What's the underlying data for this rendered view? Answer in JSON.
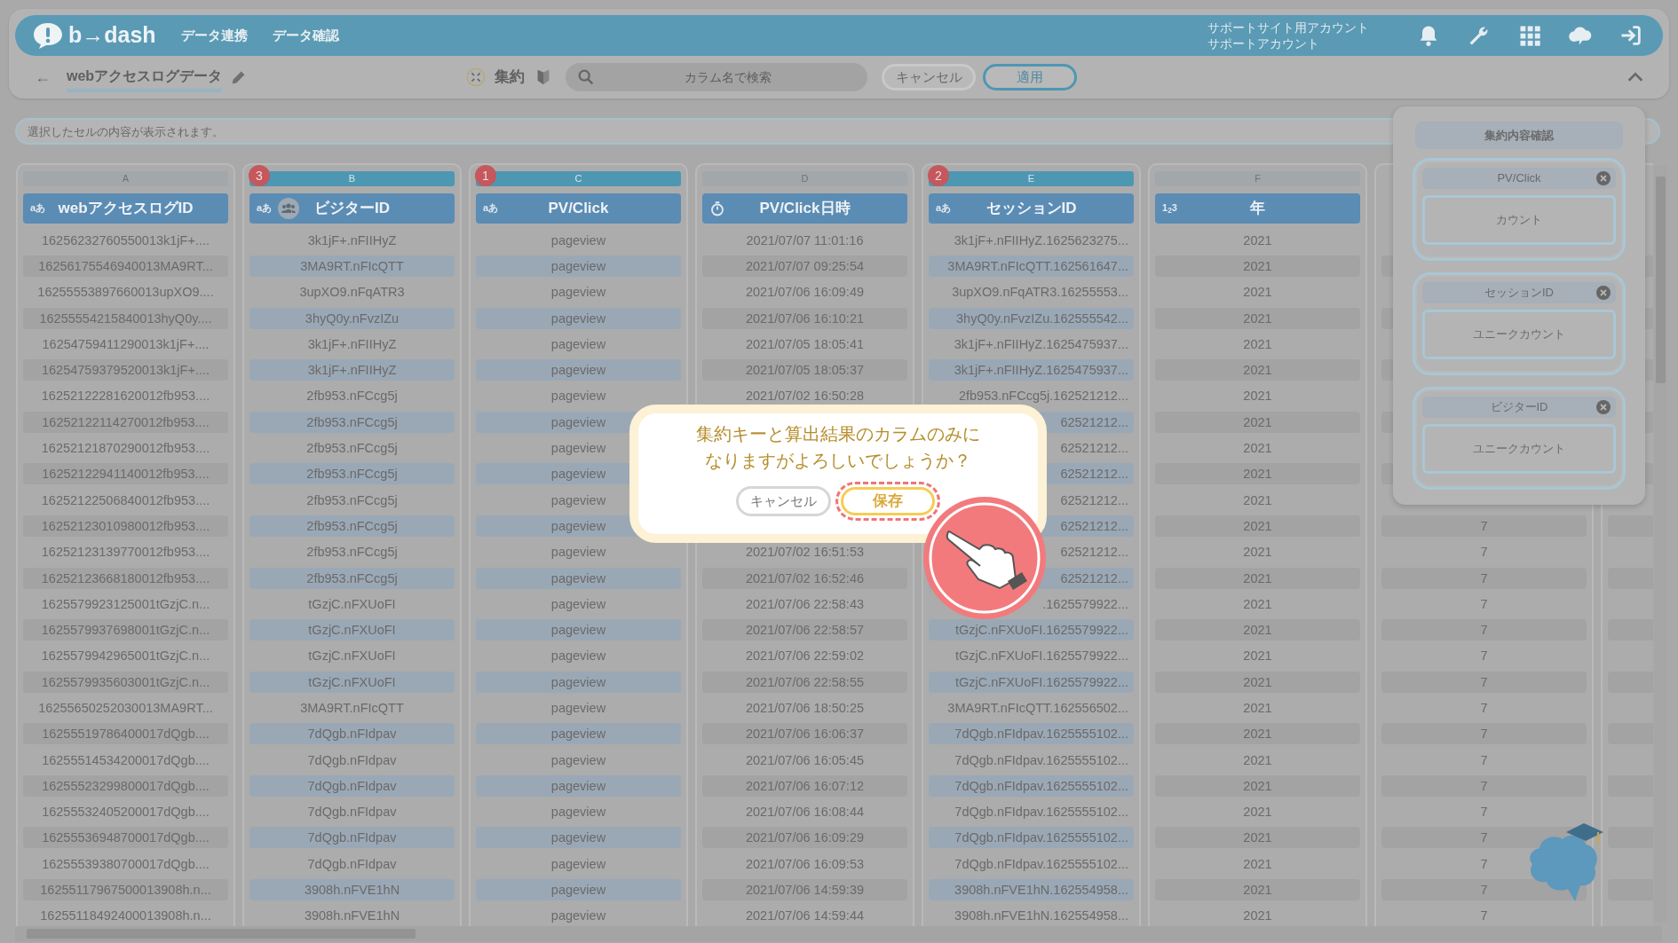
{
  "navbar": {
    "logo": "b→dash",
    "menu": [
      "データ連携",
      "データ確認"
    ],
    "account": [
      "サポートサイト用アカウント",
      "サポートアカウント"
    ]
  },
  "toolbar": {
    "back": "←",
    "title": "webアクセスログデータ",
    "aggregate_label": "集約",
    "search_placeholder": "カラム名で検索",
    "cancel": "キャンセル",
    "apply": "適用"
  },
  "cell_viewer": {
    "placeholder": "選択したセルの内容が表示されます。"
  },
  "columns": [
    {
      "letter": "A",
      "selected": false,
      "name": "webアクセスログID",
      "kind": "text",
      "type_label": "aあ",
      "visitor_key": false
    },
    {
      "letter": "B",
      "selected": true,
      "name": "ビジターID",
      "kind": "text",
      "type_label": "aあ",
      "visitor_key": true,
      "order": "3"
    },
    {
      "letter": "C",
      "selected": true,
      "name": "PV/Click",
      "kind": "text",
      "type_label": "aあ",
      "visitor_key": false,
      "order": "1"
    },
    {
      "letter": "D",
      "selected": false,
      "name": "PV/Click日時",
      "kind": "datetime",
      "visitor_key": false
    },
    {
      "letter": "E",
      "selected": true,
      "name": "セッションID",
      "kind": "text",
      "type_label": "aあ",
      "visitor_key": false,
      "order": "2"
    },
    {
      "letter": "F",
      "selected": false,
      "name": "年",
      "kind": "number",
      "type_label": "1$_{2}$3",
      "visitor_key": false
    }
  ],
  "rows": [
    {
      "cells": [
        "16256232760550013k1jF+....",
        "3k1jF+.nFIIHyZ",
        "pageview",
        "2021/07/07 11:01:16",
        "3k1jF+.nFIIHyZ.1625623275...",
        "2021"
      ]
    },
    {
      "cells": [
        "16256175546940013MA9RT...",
        "3MA9RT.nFIcQTT",
        "pageview",
        "2021/07/07 09:25:54",
        "3MA9RT.nFIcQTT.162561647...",
        "2021"
      ]
    },
    {
      "cells": [
        "16255553897660013upXO9....",
        "3upXO9.nFqATR3",
        "pageview",
        "2021/07/06 16:09:49",
        "3upXO9.nFqATR3.16255553...",
        "2021"
      ]
    },
    {
      "cells": [
        "16255554215840013hyQ0y....",
        "3hyQ0y.nFvzIZu",
        "pageview",
        "2021/07/06 16:10:21",
        "3hyQ0y.nFvzIZu.162555542...",
        "2021"
      ]
    },
    {
      "cells": [
        "16254759411290013k1jF+....",
        "3k1jF+.nFIIHyZ",
        "pageview",
        "2021/07/05 18:05:41",
        "3k1jF+.nFIIHyZ.1625475937...",
        "2021"
      ]
    },
    {
      "cells": [
        "16254759379520013k1jF+....",
        "3k1jF+.nFIIHyZ",
        "pageview",
        "2021/07/05 18:05:37",
        "3k1jF+.nFIIHyZ.1625475937...",
        "2021"
      ]
    },
    {
      "cells": [
        "16252122281620012fb953....",
        "2fb953.nFCcg5j",
        "pageview",
        "2021/07/02 16:50:28",
        "2fb953.nFCcg5j.162521212...",
        "2021"
      ]
    },
    {
      "cells": [
        "16252122114270012fb953....",
        "2fb953.nFCcg5j",
        "pageview",
        null,
        "62521212...",
        "2021"
      ]
    },
    {
      "cells": [
        "16252121870290012fb953....",
        "2fb953.nFCcg5j",
        "pageview",
        null,
        "62521212...",
        "2021"
      ]
    },
    {
      "cells": [
        "16252122941140012fb953....",
        "2fb953.nFCcg5j",
        "pageview",
        null,
        "62521212...",
        "2021"
      ]
    },
    {
      "cells": [
        "16252122506840012fb953....",
        "2fb953.nFCcg5j",
        "pageview",
        null,
        "62521212...",
        "2021"
      ]
    },
    {
      "cells": [
        "16252123010980012fb953....",
        "2fb953.nFCcg5j",
        "pageview",
        null,
        "62521212...",
        "2021"
      ],
      "column_7": "7"
    },
    {
      "cells": [
        "16252123139770012fb953....",
        "2fb953.nFCcg5j",
        "pageview",
        "2021/07/02 16:51:53",
        "62521212...",
        "2021"
      ],
      "column_7": "7"
    },
    {
      "cells": [
        "16252123668180012fb953....",
        "2fb953.nFCcg5j",
        "pageview",
        "2021/07/02 16:52:46",
        "62521212...",
        "2021"
      ],
      "column_7": "7"
    },
    {
      "cells": [
        "1625579923125001tGzjC.n...",
        "tGzjC.nFXUoFI",
        "pageview",
        "2021/07/06 22:58:43",
        ".1625579922...",
        "2021"
      ],
      "column_7": "7"
    },
    {
      "cells": [
        "1625579937698001tGzjC.n...",
        "tGzjC.nFXUoFI",
        "pageview",
        "2021/07/06 22:58:57",
        "tGzjC.nFXUoFI.1625579922...",
        "2021"
      ],
      "column_7": "7"
    },
    {
      "cells": [
        "1625579942965001tGzjC.n...",
        "tGzjC.nFXUoFI",
        "pageview",
        "2021/07/06 22:59:02",
        "tGzjC.nFXUoFI.1625579922...",
        "2021"
      ],
      "column_7": "7"
    },
    {
      "cells": [
        "1625579935603001tGzjC.n...",
        "tGzjC.nFXUoFI",
        "pageview",
        "2021/07/06 22:58:55",
        "tGzjC.nFXUoFI.1625579922...",
        "2021"
      ],
      "column_7": "7"
    },
    {
      "cells": [
        "16255650252030013MA9RT...",
        "3MA9RT.nFIcQTT",
        "pageview",
        "2021/07/06 18:50:25",
        "3MA9RT.nFIcQTT.162556502...",
        "2021"
      ],
      "column_7": "7"
    },
    {
      "cells": [
        "16255519786400017dQgb....",
        "7dQgb.nFIdpav",
        "pageview",
        "2021/07/06 16:06:37",
        "7dQgb.nFIdpav.1625555102...",
        "2021"
      ],
      "column_7": "7"
    },
    {
      "cells": [
        "16255514534200017dQgb....",
        "7dQgb.nFIdpav",
        "pageview",
        "2021/07/06 16:05:45",
        "7dQgb.nFIdpav.1625555102...",
        "2021"
      ],
      "column_7": "7"
    },
    {
      "cells": [
        "16255523299800017dQgb....",
        "7dQgb.nFIdpav",
        "pageview",
        "2021/07/06 16:07:12",
        "7dQgb.nFIdpav.1625555102...",
        "2021"
      ],
      "column_7": "7"
    },
    {
      "cells": [
        "16255532405200017dQgb....",
        "7dQgb.nFIdpav",
        "pageview",
        "2021/07/06 16:08:44",
        "7dQgb.nFIdpav.1625555102...",
        "2021"
      ],
      "column_7": "7"
    },
    {
      "cells": [
        "16255536948700017dQgb....",
        "7dQgb.nFIdpav",
        "pageview",
        "2021/07/06 16:09:29",
        "7dQgb.nFIdpav.1625555102...",
        "2021"
      ],
      "column_7": "7"
    },
    {
      "cells": [
        "16255539380700017dQgb....",
        "7dQgb.nFIdpav",
        "pageview",
        "2021/07/06 16:09:53",
        "7dQgb.nFIdpav.1625555102...",
        "2021"
      ],
      "column_7": "7"
    },
    {
      "cells": [
        "16255117967500013908h.n...",
        "3908h.nFVE1hN",
        "pageview",
        "2021/07/06 14:59:39",
        "3908h.nFVE1hN.162554958...",
        "2021"
      ],
      "column_7": "7"
    },
    {
      "cells": [
        "16255118492400013908h.n...",
        "3908h.nFVE1hN",
        "pageview",
        "2021/07/06 14:59:44",
        "3908h.nFVE1hN.162554958...",
        "2021"
      ],
      "column_7": "7"
    }
  ],
  "summary_panel": {
    "title": "集約内容確認",
    "items": [
      {
        "column": "PV/Click",
        "method": "カウント"
      },
      {
        "column": "セッションID",
        "method": "ユニークカウント"
      },
      {
        "column": "ビジターID",
        "method": "ユニークカウント"
      }
    ]
  },
  "dialog": {
    "message": [
      "集約キーと算出結果のカラムのみに",
      "なりますがよろしいでしょうか？"
    ],
    "buttons": [
      {
        "label": "キャンセル",
        "highlighted": false
      },
      {
        "label": "保存",
        "highlighted": true
      }
    ]
  }
}
